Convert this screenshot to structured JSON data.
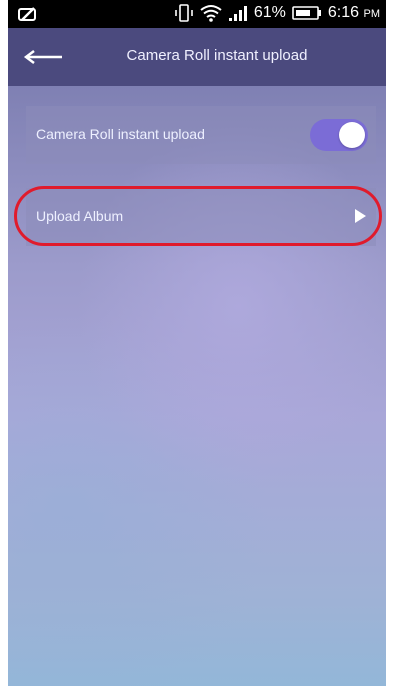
{
  "status_bar": {
    "battery_percent": "61%",
    "time": "6:16",
    "time_suffix": "PM"
  },
  "app_bar": {
    "title": "Camera Roll instant upload"
  },
  "settings": {
    "instant_upload_label": "Camera Roll instant upload",
    "instant_upload_enabled": true,
    "upload_album_label": "Upload Album"
  },
  "colors": {
    "app_bar": "#4b4a7e",
    "toggle_on": "#7b6cd6",
    "highlight": "#e01b2c"
  },
  "icons": {
    "status_left": "edit-icon",
    "vibrate": "vibrate-icon",
    "wifi": "wifi-icon",
    "signal": "signal-icon",
    "battery": "battery-icon",
    "back": "back-arrow-icon",
    "chevron": "chevron-right-icon"
  }
}
